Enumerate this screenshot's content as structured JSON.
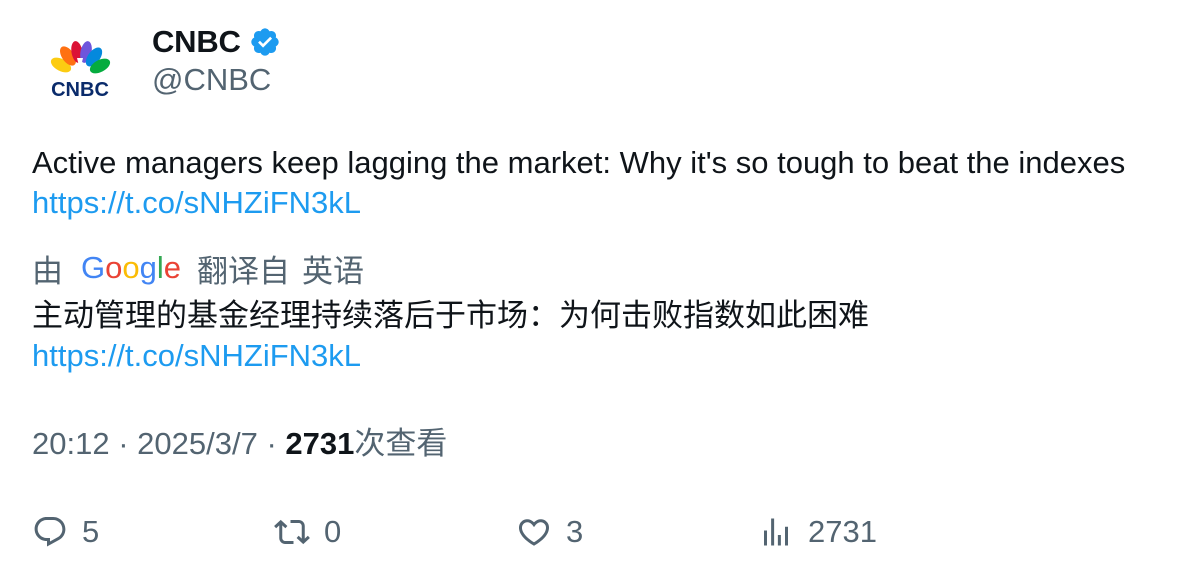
{
  "author": {
    "display_name": "CNBC",
    "handle": "@CNBC",
    "verified": true,
    "logo_text": "CNBC"
  },
  "tweet": {
    "text_line1": "Active managers keep lagging the market: Why it's so tough to beat the indexes",
    "link": "https://t.co/sNHZiFN3kL"
  },
  "translation": {
    "prefix": "由",
    "provider": "Google",
    "suffix": "翻译自",
    "language": "英语",
    "text_line1": "主动管理的基金经理持续落后于市场：为何击败指数如此困难",
    "link": "https://t.co/sNHZiFN3kL"
  },
  "meta": {
    "time": "20:12",
    "separator": "·",
    "date": "2025/3/7",
    "views_count": "2731",
    "views_label": "次查看"
  },
  "actions": {
    "replies": "5",
    "retweets": "0",
    "likes": "3",
    "views": "2731"
  },
  "icons": {
    "reply": "reply-icon",
    "retweet": "retweet-icon",
    "like": "heart-icon",
    "views": "analytics-icon",
    "verified": "verified-badge-icon"
  },
  "colors": {
    "link": "#1d9bf0",
    "secondary_text": "#536471",
    "verified": "#1d9bf0"
  }
}
